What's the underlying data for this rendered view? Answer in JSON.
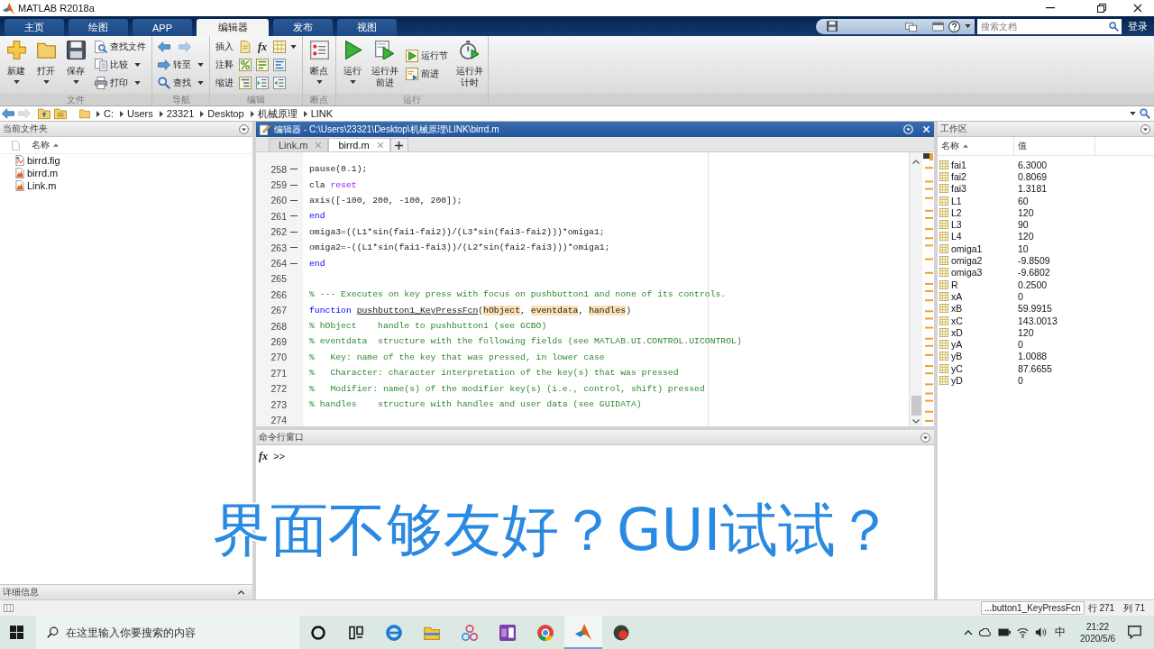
{
  "window": {
    "title": "MATLAB R2018a"
  },
  "ribbon_tabs": [
    {
      "label": "主页",
      "selected": false
    },
    {
      "label": "绘图",
      "selected": false
    },
    {
      "label": "APP",
      "selected": false
    },
    {
      "label": "编辑器",
      "selected": true
    },
    {
      "label": "发布",
      "selected": false
    },
    {
      "label": "视图",
      "selected": false
    }
  ],
  "doc_search": {
    "placeholder": "搜索文档"
  },
  "login": "登录",
  "toolstrip": [
    {
      "label": "文件",
      "items": [
        {
          "kind": "large",
          "label": "新建",
          "dropdown": true
        },
        {
          "kind": "large",
          "label": "打开",
          "dropdown": true
        },
        {
          "kind": "large",
          "label": "保存",
          "dropdown": true
        },
        {
          "kind": "small",
          "label": "查找文件",
          "dropdown": false
        },
        {
          "kind": "small",
          "label": "比较",
          "dropdown": true
        },
        {
          "kind": "small",
          "label": "打印",
          "dropdown": true
        }
      ]
    },
    {
      "label": "导航",
      "items": [
        {
          "kind": "nav",
          "back_disabled": false,
          "forward_disabled": true
        },
        {
          "kind": "small",
          "label": "转至",
          "dropdown": true
        },
        {
          "kind": "small",
          "label": "查找",
          "dropdown": true
        }
      ]
    },
    {
      "label": "编辑",
      "items": [
        {
          "kind": "tools",
          "label": "插入",
          "glyph": "fx",
          "dropdown": true
        },
        {
          "kind": "tools",
          "label": "注释",
          "dropdown": false
        },
        {
          "kind": "tools",
          "label": "缩进",
          "dropdown": false
        }
      ]
    },
    {
      "label": "断点",
      "items": [
        {
          "kind": "large",
          "label": "断点",
          "dropdown": true
        }
      ]
    },
    {
      "label": "运行",
      "items": [
        {
          "kind": "large",
          "label": "运行",
          "dropdown": true
        },
        {
          "kind": "large",
          "label": "运行并前进",
          "dropdown": false
        },
        {
          "kind": "small",
          "label": "运行节",
          "dropdown": false
        },
        {
          "kind": "small",
          "label": "前进",
          "dropdown": false
        },
        {
          "kind": "large",
          "label": "运行并计时",
          "dropdown": false
        }
      ]
    }
  ],
  "address_bar": {
    "path": [
      "C:",
      "Users",
      "23321",
      "Desktop",
      "机械原理",
      "LINK"
    ]
  },
  "current_folder": {
    "title": "当前文件夹",
    "columns": [
      {
        "label": "名称",
        "sorted": true
      }
    ],
    "files": [
      {
        "name": "birrd.fig",
        "kind": "fig"
      },
      {
        "name": "birrd.m",
        "kind": "m"
      },
      {
        "name": "Link.m",
        "kind": "m"
      }
    ],
    "details_title": "详细信息"
  },
  "editor": {
    "title": "编辑器 - C:\\Users\\23321\\Desktop\\机械原理\\LINK\\birrd.m",
    "tabs": [
      {
        "label": "Link.m",
        "selected": false
      },
      {
        "label": "birrd.m",
        "selected": true
      }
    ],
    "lines": [
      {
        "number": "258",
        "executable": true,
        "tokens": [
          {
            "kind": "code",
            "text": "pause(0.1);"
          }
        ]
      },
      {
        "number": "259",
        "executable": true,
        "tokens": [
          {
            "kind": "code",
            "text": "cla "
          },
          {
            "kind": "string",
            "text": "reset"
          }
        ]
      },
      {
        "number": "260",
        "executable": true,
        "tokens": [
          {
            "kind": "code",
            "text": "axis([-100, 200, -100, 200]);"
          }
        ]
      },
      {
        "number": "261",
        "executable": true,
        "tokens": [
          {
            "kind": "keyword",
            "text": "end"
          }
        ]
      },
      {
        "number": "262",
        "executable": true,
        "tokens": [
          {
            "kind": "code",
            "text": "omiga3=((L1*sin(fai1-fai2))/(L3*sin(fai3-fai2)))*omiga1;"
          }
        ]
      },
      {
        "number": "263",
        "executable": true,
        "tokens": [
          {
            "kind": "code",
            "text": "omiga2=-((L1*sin(fai1-fai3))/(L2*sin(fai2-fai3)))*omiga1;"
          }
        ]
      },
      {
        "number": "264",
        "executable": true,
        "tokens": [
          {
            "kind": "keyword",
            "text": "end"
          }
        ]
      },
      {
        "number": "265",
        "executable": false
      },
      {
        "number": "266",
        "executable": false,
        "tokens": [
          {
            "kind": "comment",
            "text": "% --- Executes on key press with focus on pushbutton1 and none of its controls."
          }
        ]
      },
      {
        "number": "267",
        "executable": false,
        "tokens": [
          {
            "kind": "keyword",
            "text": "function "
          },
          {
            "kind": "function",
            "text": "pushbutton1_KeyPressFcn"
          },
          {
            "kind": "code",
            "text": "("
          },
          {
            "kind": "highlight",
            "text": "hObject"
          },
          {
            "kind": "code",
            "text": ", "
          },
          {
            "kind": "highlight",
            "text": "eventdata"
          },
          {
            "kind": "code",
            "text": ", "
          },
          {
            "kind": "highlight",
            "text": "handles"
          },
          {
            "kind": "code",
            "text": ")"
          }
        ]
      },
      {
        "number": "268",
        "executable": false,
        "tokens": [
          {
            "kind": "comment",
            "text": "% hObject    handle to pushbutton1 (see GCBO)"
          }
        ]
      },
      {
        "number": "269",
        "executable": false,
        "tokens": [
          {
            "kind": "comment",
            "text": "% eventdata  structure with the following fields (see MATLAB.UI.CONTROL.UICONTROL)"
          }
        ]
      },
      {
        "number": "270",
        "executable": false,
        "tokens": [
          {
            "kind": "comment",
            "text": "%   Key: name of the key that was pressed, in lower case"
          }
        ]
      },
      {
        "number": "271",
        "executable": false,
        "tokens": [
          {
            "kind": "comment",
            "text": "%   Character: character interpretation of the key(s) that was pressed"
          }
        ]
      },
      {
        "number": "272",
        "executable": false,
        "tokens": [
          {
            "kind": "comment",
            "text": "%   Modifier: name(s) of the modifier key(s) (i.e., control, shift) pressed"
          }
        ]
      },
      {
        "number": "273",
        "executable": false,
        "tokens": [
          {
            "kind": "comment",
            "text": "% handles    structure with handles and user data (see GUIDATA)"
          }
        ]
      },
      {
        "number": "274",
        "executable": false
      }
    ]
  },
  "command_window": {
    "title": "命令行窗口",
    "fx": "fx",
    "prompt": ">>"
  },
  "workspace": {
    "title": "工作区",
    "columns": [
      {
        "label": "名称",
        "sorted": true
      },
      {
        "label": "值",
        "sorted": false
      }
    ],
    "variables": [
      {
        "name": "fai1",
        "value": "6.3000"
      },
      {
        "name": "fai2",
        "value": "0.8069"
      },
      {
        "name": "fai3",
        "value": "1.3181"
      },
      {
        "name": "L1",
        "value": "60"
      },
      {
        "name": "L2",
        "value": "120"
      },
      {
        "name": "L3",
        "value": "90"
      },
      {
        "name": "L4",
        "value": "120"
      },
      {
        "name": "omiga1",
        "value": "10"
      },
      {
        "name": "omiga2",
        "value": "-9.8509"
      },
      {
        "name": "omiga3",
        "value": "-9.6802"
      },
      {
        "name": "R",
        "value": "0.2500"
      },
      {
        "name": "xA",
        "value": "0"
      },
      {
        "name": "xB",
        "value": "59.9915"
      },
      {
        "name": "xC",
        "value": "143.0013"
      },
      {
        "name": "xD",
        "value": "120"
      },
      {
        "name": "yA",
        "value": "0"
      },
      {
        "name": "yB",
        "value": "1.0088"
      },
      {
        "name": "yC",
        "value": "87.6655"
      },
      {
        "name": "yD",
        "value": "0"
      }
    ]
  },
  "status_bar": {
    "function_name": "...button1_KeyPressFcn",
    "line": "行 271",
    "column": "列 71"
  },
  "caption": "界面不够友好？GUI试试？",
  "taskbar": {
    "search_placeholder": "在这里输入你要搜索的内容",
    "apps": [
      {
        "selected": false
      },
      {
        "selected": false
      },
      {
        "selected": false
      },
      {
        "selected": false
      },
      {
        "selected": false
      },
      {
        "selected": true
      },
      {
        "selected": false
      }
    ],
    "ime": "中",
    "time": "21:22",
    "date": "2020/5/6"
  }
}
